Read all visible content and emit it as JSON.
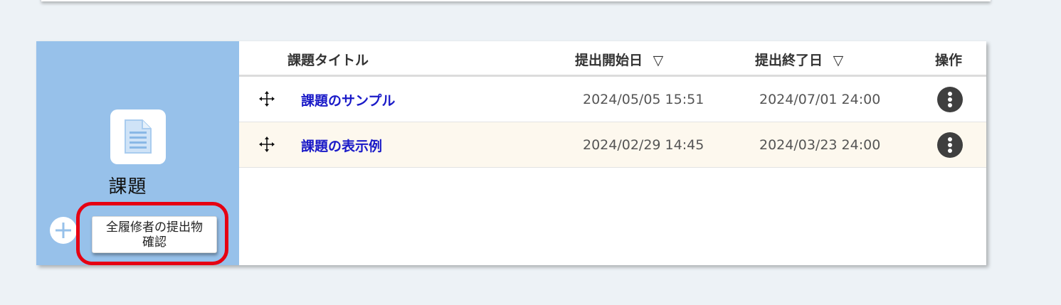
{
  "header": {
    "title_col": "課題タイトル",
    "start_col": "提出開始日",
    "end_col": "提出終了日",
    "ops_col": "操作",
    "sort_glyph": "▽"
  },
  "sidebar": {
    "icon": "document-icon",
    "title": "課題",
    "add_icon": "plus-icon",
    "submissions_button_line1": "全履修者の提出物",
    "submissions_button_line2": "確認",
    "highlight_color": "#e60012"
  },
  "rows": [
    {
      "title": "課題のサンプル",
      "start": "2024/05/05 15:51",
      "end": "2024/07/01 24:00"
    },
    {
      "title": "課題の表示例",
      "start": "2024/02/29 14:45",
      "end": "2024/03/23 24:00"
    }
  ],
  "colors": {
    "sidebar_bg": "#97c1ea",
    "link": "#1a1ac8",
    "alt_row": "#fdf8ee"
  }
}
